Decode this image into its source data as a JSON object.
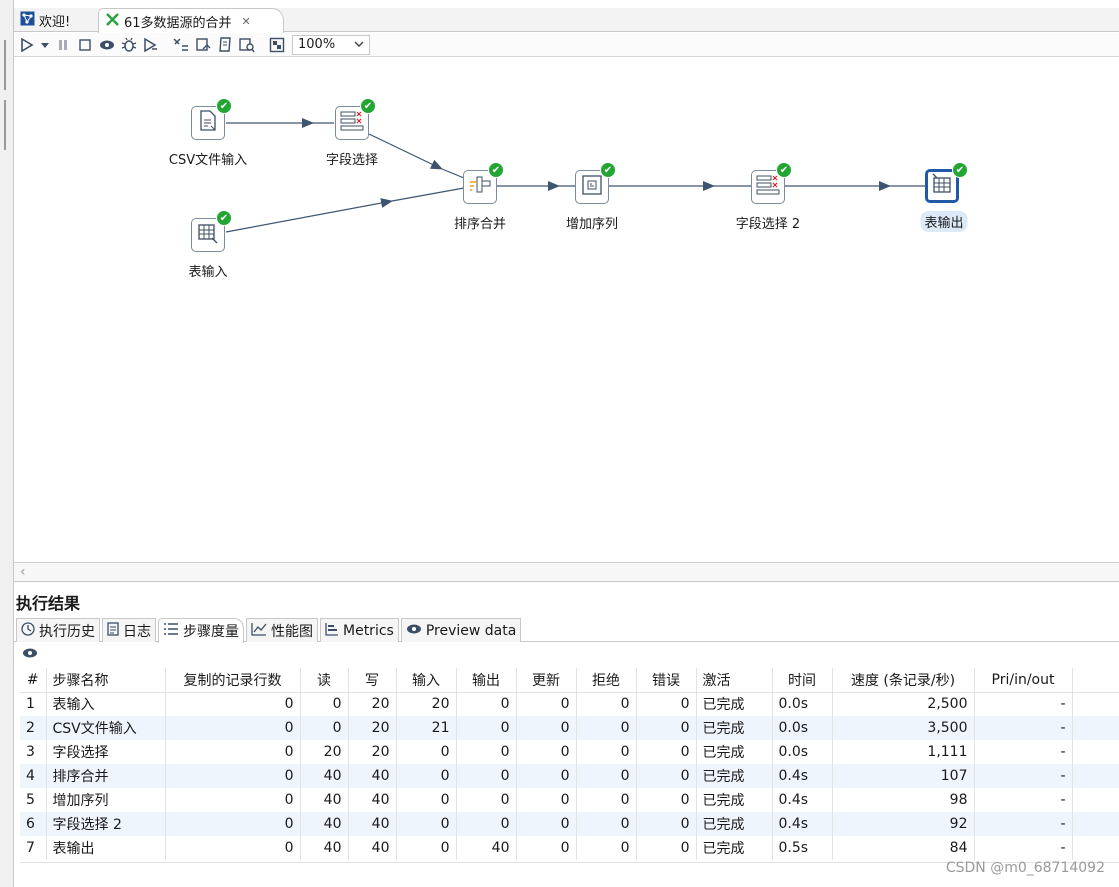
{
  "tabs": [
    {
      "label": "欢迎!",
      "icon": "welcome-icon"
    },
    {
      "label": "61多数据源的合并",
      "icon": "transformation-icon",
      "close": "✕"
    }
  ],
  "toolbar": {
    "zoom": "100%",
    "icons": [
      "run-icon",
      "dropdown-icon",
      "pause-icon",
      "stop-icon",
      "preview-icon",
      "debug-icon",
      "replay-icon",
      "verify-icon",
      "impact-icon",
      "sql-icon",
      "explore-db-icon",
      "show-results-icon"
    ]
  },
  "canvas": {
    "steps": [
      {
        "id": "csv",
        "label": "CSV文件输入",
        "icon": "csv-file-icon"
      },
      {
        "id": "select1",
        "label": "字段选择",
        "icon": "select-values-icon"
      },
      {
        "id": "tablein",
        "label": "表输入",
        "icon": "table-input-icon"
      },
      {
        "id": "sortmerge",
        "label": "排序合并",
        "icon": "sorted-merge-icon"
      },
      {
        "id": "seq",
        "label": "增加序列",
        "icon": "add-sequence-icon"
      },
      {
        "id": "select2",
        "label": "字段选择 2",
        "icon": "select-values-icon"
      },
      {
        "id": "tableout",
        "label": "表输出",
        "icon": "table-output-icon"
      }
    ],
    "status_icon": "check-icon",
    "status_glyph": "✔"
  },
  "results": {
    "title": "执行结果",
    "tabs": [
      {
        "label": "执行历史",
        "icon": "history-icon"
      },
      {
        "label": "日志",
        "icon": "log-icon"
      },
      {
        "label": "步骤度量",
        "icon": "metrics-list-icon"
      },
      {
        "label": "性能图",
        "icon": "performance-chart-icon"
      },
      {
        "label": "Metrics",
        "icon": "metrics-icon"
      },
      {
        "label": "Preview data",
        "icon": "preview-eye-icon"
      }
    ],
    "active_tab": "步骤度量",
    "columns": [
      "#",
      "步骤名称",
      "复制的记录行数",
      "读",
      "写",
      "输入",
      "输出",
      "更新",
      "拒绝",
      "错误",
      "激活",
      "时间",
      "速度 (条记录/秒)",
      "Pri/in/out"
    ],
    "rows": [
      [
        "1",
        "表输入",
        "0",
        "0",
        "20",
        "20",
        "0",
        "0",
        "0",
        "0",
        "已完成",
        "0.0s",
        "2,500",
        "-"
      ],
      [
        "2",
        "CSV文件输入",
        "0",
        "0",
        "20",
        "21",
        "0",
        "0",
        "0",
        "0",
        "已完成",
        "0.0s",
        "3,500",
        "-"
      ],
      [
        "3",
        "字段选择",
        "0",
        "20",
        "20",
        "0",
        "0",
        "0",
        "0",
        "0",
        "已完成",
        "0.0s",
        "1,111",
        "-"
      ],
      [
        "4",
        "排序合并",
        "0",
        "40",
        "40",
        "0",
        "0",
        "0",
        "0",
        "0",
        "已完成",
        "0.4s",
        "107",
        "-"
      ],
      [
        "5",
        "增加序列",
        "0",
        "40",
        "40",
        "0",
        "0",
        "0",
        "0",
        "0",
        "已完成",
        "0.4s",
        "98",
        "-"
      ],
      [
        "6",
        "字段选择 2",
        "0",
        "40",
        "40",
        "0",
        "0",
        "0",
        "0",
        "0",
        "已完成",
        "0.4s",
        "92",
        "-"
      ],
      [
        "7",
        "表输出",
        "0",
        "40",
        "40",
        "0",
        "40",
        "0",
        "0",
        "0",
        "已完成",
        "0.5s",
        "84",
        "-"
      ]
    ]
  },
  "watermark": "CSDN @m0_68714092",
  "colors": {
    "accent": "#1e5aa8",
    "ok": "#22a532",
    "hop": "#3d5570",
    "row_alt": "#eef5fc"
  }
}
